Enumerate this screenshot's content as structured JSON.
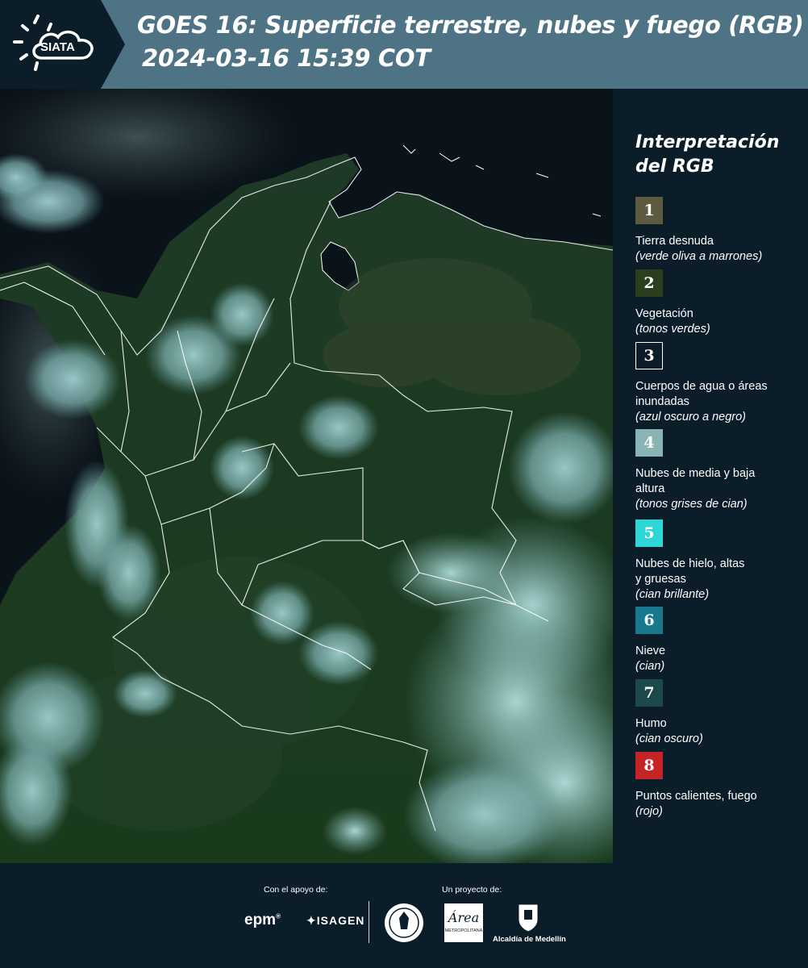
{
  "header": {
    "logo_text": "SIATA",
    "title_line1": "GOES 16: Superficie terrestre, nubes y fuego (RGB)",
    "title_line2": "2024-03-16 15:39 COT"
  },
  "colors": {
    "header_bg": "#4e7385",
    "panel_bg": "#0c1d2a",
    "map_land": "#1d3a22",
    "map_ocean": "#0a121a",
    "borders": "#ffffff"
  },
  "legend": {
    "title_line1": "Interpretación",
    "title_line2": "del RGB",
    "items": [
      {
        "number": "1",
        "color": "#5e5c40",
        "label": "Tierra desnuda",
        "desc": "(verde oliva a marrones)"
      },
      {
        "number": "2",
        "color": "#2a3f1e",
        "label": "Vegetación",
        "desc": "(tonos verdes)"
      },
      {
        "number": "3",
        "color": "#0c1d2a",
        "label": "Cuerpos de agua o áreas inundadas",
        "desc": "(azul oscuro a negro)"
      },
      {
        "number": "4",
        "color": "#8ab4b3",
        "label": "Nubes de media y baja altura",
        "desc": "(tonos grises de cian)"
      },
      {
        "number": "5",
        "color": "#2fd6d6",
        "label": "Nubes de hielo, altas y gruesas",
        "desc": "(cian brillante)"
      },
      {
        "number": "6",
        "color": "#17788e",
        "label": "Nieve",
        "desc": "(cian)"
      },
      {
        "number": "7",
        "color": "#1c4a4a",
        "label": "Humo",
        "desc": "(cian oscuro)"
      },
      {
        "number": "8",
        "color": "#c42426",
        "label": "Puntos calientes, fuego",
        "desc": "(rojo)"
      }
    ]
  },
  "footer": {
    "support_label": "Con el apoyo de:",
    "project_label": "Un proyecto de:",
    "brand_epm": "epm",
    "brand_isagen": "ISAGEN",
    "brand_area": "Área",
    "brand_area_sub": "METROPOLITANA",
    "brand_alcaldia": "Alcaldía de Medellín"
  }
}
